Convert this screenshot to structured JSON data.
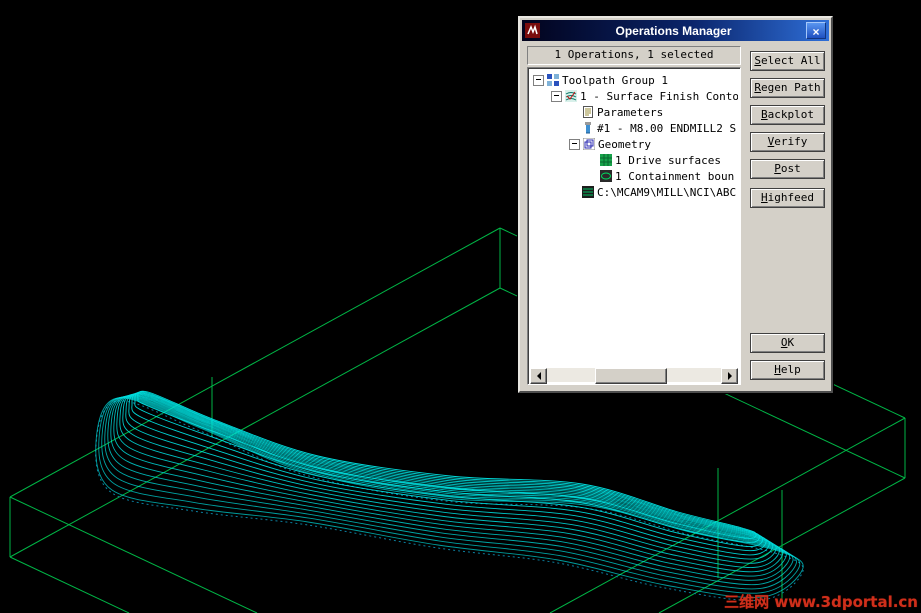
{
  "window": {
    "title": "Operations Manager"
  },
  "status": "1 Operations, 1 selected",
  "tree": {
    "items": [
      {
        "label": "Toolpath Group 1",
        "icon": "toolpath-group-icon"
      },
      {
        "label": "1 - Surface Finish Conto",
        "icon": "operation-icon"
      },
      {
        "label": "Parameters",
        "icon": "parameters-icon"
      },
      {
        "label": "#1 - M8.00 ENDMILL2 S",
        "icon": "tool-icon"
      },
      {
        "label": "Geometry",
        "icon": "geometry-icon"
      },
      {
        "label": "1 Drive surfaces",
        "icon": "drive-surfaces-icon"
      },
      {
        "label": "1 Containment boun",
        "icon": "containment-icon"
      },
      {
        "label": "C:\\MCAM9\\MILL\\NCI\\ABC",
        "icon": "nci-file-icon"
      }
    ]
  },
  "buttons": {
    "select_all": "Select All",
    "regen_path": "Regen Path",
    "backplot": "Backplot",
    "verify": "Verify",
    "post": "Post",
    "highfeed": "Highfeed",
    "ok": "OK",
    "help": "Help"
  },
  "watermark": "三维网 www.3dportal.cn",
  "colors": {
    "wireframe": "#00b546",
    "toolpath": "#00dede",
    "title_accent": "#0a246a"
  }
}
